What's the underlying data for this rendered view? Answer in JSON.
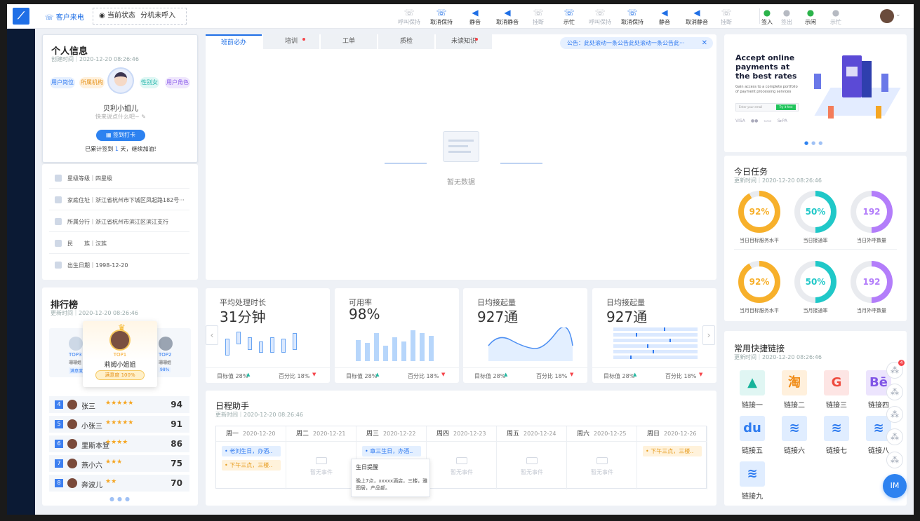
{
  "topbar": {
    "incoming_call": "客户来电",
    "status_label": "当前状态",
    "status_value": "分机未呼入",
    "buttons": [
      {
        "label": "呼叫保持",
        "state": "disabled"
      },
      {
        "label": "取消保持",
        "state": "active"
      },
      {
        "label": "静音",
        "state": "active"
      },
      {
        "label": "取消静音",
        "state": "active"
      },
      {
        "label": "挂断",
        "state": "disabled"
      },
      {
        "label": "示忙",
        "state": "active"
      },
      {
        "label": "呼叫保持",
        "state": "disabled"
      },
      {
        "label": "取消保持",
        "state": "active"
      },
      {
        "label": "静音",
        "state": "active"
      },
      {
        "label": "取消静音",
        "state": "active"
      },
      {
        "label": "挂断",
        "state": "disabled"
      },
      {
        "label": "签入",
        "state": "green"
      },
      {
        "label": "签出",
        "state": "disabled"
      },
      {
        "label": "示闲",
        "state": "green"
      },
      {
        "label": "示忙",
        "state": "disabled"
      }
    ]
  },
  "profile": {
    "title": "个人信息",
    "created": "创建时间｜2020-12-20 08:26:46",
    "tags": [
      "用户岗位",
      "所属机构",
      "性别女",
      "用户角色"
    ],
    "name": "贝利小姐儿",
    "signature": "快来说点什么吧~",
    "signin_button": "签到打卡",
    "signin_prefix": "已累计签到",
    "signin_days": "1",
    "signin_suffix": "天，继续加油!",
    "details": [
      "星级等级｜四星级",
      "家庭住址｜浙江省杭州市下城区凤起路182号···",
      "所属分行｜浙江省杭州市滨江区滨江支行",
      "民　　族｜汉族",
      "出生日期｜1998-12-20"
    ]
  },
  "ranking": {
    "title": "排行榜",
    "updated": "更新时间｜2020-12-20 08:26:46",
    "top1_badge": "TOP1",
    "top1_name": "莉姆小姐姐",
    "top1_score": "满意度 100%",
    "top2": "TOP2",
    "top3": "TOP3",
    "side_left_name": "珊珊姐",
    "side_right_name": "珊珊姐",
    "side_left_score": "满意度",
    "side_right_score": "98%",
    "rows": [
      {
        "no": "4",
        "name": "张三",
        "stars": "★★★★★",
        "score": "94"
      },
      {
        "no": "5",
        "name": "小张三",
        "stars": "★★★★★",
        "score": "91"
      },
      {
        "no": "6",
        "name": "里斯本登",
        "stars": "★★★★",
        "score": "86"
      },
      {
        "no": "7",
        "name": "燕小六",
        "stars": "★★★",
        "score": "75"
      },
      {
        "no": "8",
        "name": "奔波儿",
        "stars": "★★",
        "score": "70"
      }
    ]
  },
  "tabs": [
    {
      "label": "班前必办",
      "dot": false,
      "active": true
    },
    {
      "label": "培训",
      "dot": true,
      "active": false
    },
    {
      "label": "工单",
      "dot": false,
      "active": false
    },
    {
      "label": "质检",
      "dot": false,
      "active": false
    },
    {
      "label": "未读知识",
      "dot": true,
      "active": false
    }
  ],
  "notice": "公告：此处滚动一条公告此处滚动一条公告此···",
  "empty_text": "暂无数据",
  "stats": [
    {
      "label": "平均处理时长",
      "value": "31分钟",
      "target": "目标值 28%",
      "ratio": "百分比 18%"
    },
    {
      "label": "可用率",
      "value": "98%",
      "target": "目标值 28%",
      "ratio": "百分比 18%"
    },
    {
      "label": "日均接起量",
      "value": "927通",
      "target": "目标值 28%",
      "ratio": "百分比 18%"
    },
    {
      "label": "日均接起量",
      "value": "927通",
      "target": "目标值 28%",
      "ratio": "百分比 18%"
    }
  ],
  "schedule": {
    "title": "日程助手",
    "updated": "更新时间｜2020-12-20 08:26:46",
    "days": [
      {
        "day": "周一",
        "date": "2020-12-20",
        "events": [
          {
            "text": "• 老刘生日，办酒..",
            "type": "b"
          },
          {
            "text": "• 下午三点，三楼..",
            "type": "o"
          }
        ]
      },
      {
        "day": "周二",
        "date": "2020-12-21",
        "events": []
      },
      {
        "day": "周三",
        "date": "2020-12-22",
        "events": [
          {
            "text": "• 章三生日，办酒..",
            "type": "b"
          }
        ]
      },
      {
        "day": "周四",
        "date": "2020-12-23",
        "events": []
      },
      {
        "day": "周五",
        "date": "2020-12-24",
        "events": []
      },
      {
        "day": "周六",
        "date": "2020-12-25",
        "events": []
      },
      {
        "day": "周日",
        "date": "2020-12-26",
        "events": [
          {
            "text": "• 下午三点，三楼..",
            "type": "o"
          }
        ]
      }
    ],
    "empty_event": "暂无事件",
    "tooltip_title": "生日提醒",
    "tooltip_body": "晚上7点，xxxxx酒店，三楼，雅图居，产品部。"
  },
  "banner": {
    "headline": "Accept online payments at the best rates",
    "sub": "Gain access to a complete portfolio of payment processing services",
    "email_placeholder": "Enter your email",
    "cta": "Try it free",
    "brands": [
      "VISA",
      "●●",
      "▭▭",
      "S▸PA"
    ]
  },
  "tasks": {
    "title": "今日任务",
    "updated": "更新时间｜2020-12-20 08:26:46",
    "rings": [
      {
        "value": "92%",
        "pct": 0.92,
        "label": "当日目标服务水平",
        "color": "#f7b02b"
      },
      {
        "value": "50%",
        "pct": 0.5,
        "label": "当日接通率",
        "color": "#20c8c8"
      },
      {
        "value": "192",
        "pct": 0.5,
        "label": "当日外呼数量",
        "color": "#b37dfa"
      },
      {
        "value": "92%",
        "pct": 0.92,
        "label": "当月目标服务水平",
        "color": "#f7b02b"
      },
      {
        "value": "50%",
        "pct": 0.5,
        "label": "当月接通率",
        "color": "#20c8c8"
      },
      {
        "value": "192",
        "pct": 0.5,
        "label": "当月外呼数量",
        "color": "#b37dfa"
      }
    ]
  },
  "quicklinks": {
    "title": "常用快捷链接",
    "updated": "更新时间｜2020-12-20 08:26:46",
    "items": [
      {
        "label": "链接一",
        "glyph": "▲",
        "bg": "#e0f6f3",
        "fg": "#17b39a"
      },
      {
        "label": "链接二",
        "glyph": "淘",
        "bg": "#fff0dc",
        "fg": "#f08a14"
      },
      {
        "label": "链接三",
        "glyph": "G",
        "bg": "#fde5e4",
        "fg": "#ee4b3e"
      },
      {
        "label": "链接四",
        "glyph": "Bē",
        "bg": "#ece4fd",
        "fg": "#8156e6"
      },
      {
        "label": "链接五",
        "glyph": "du",
        "bg": "#e0edff",
        "fg": "#2f7cf0"
      },
      {
        "label": "链接六",
        "glyph": "≋",
        "bg": "#e0edff",
        "fg": "#2f7cf0"
      },
      {
        "label": "链接七",
        "glyph": "≋",
        "bg": "#e0edff",
        "fg": "#2f7cf0"
      },
      {
        "label": "链接八",
        "glyph": "≋",
        "bg": "#e0edff",
        "fg": "#2f7cf0"
      },
      {
        "label": "链接九",
        "glyph": "≋",
        "bg": "#e0edff",
        "fg": "#2f7cf0"
      }
    ]
  },
  "fab": {
    "im": "IM",
    "badge": "4"
  },
  "colors": {
    "accent": "#1f6fe6",
    "orange": "#f7b02b",
    "teal": "#20c8c8",
    "purple": "#b37dfa"
  }
}
